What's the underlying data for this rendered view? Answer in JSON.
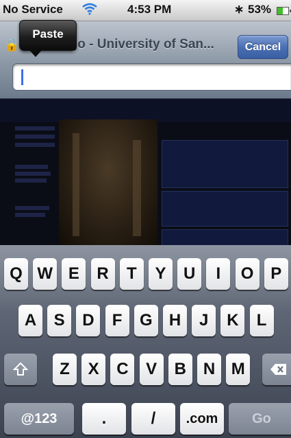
{
  "status_bar": {
    "carrier": "No Service",
    "wifi_icon": "wifi-icon",
    "time": "4:53 PM",
    "bluetooth_icon": "bluetooth-icon",
    "battery_percent": "53%",
    "battery_level": 0.53,
    "battery_color": "#3fbf28"
  },
  "address_bar": {
    "lock_icon": "lock-icon",
    "page_title": "San Diego - University of San...",
    "cancel_label": "Cancel",
    "url_value": "",
    "caret_color": "#3b6ef0"
  },
  "paste_popup": {
    "label": "Paste"
  },
  "keyboard": {
    "row1": [
      "Q",
      "W",
      "E",
      "R",
      "T",
      "Y",
      "U",
      "I",
      "O",
      "P"
    ],
    "row2": [
      "A",
      "S",
      "D",
      "F",
      "G",
      "H",
      "J",
      "K",
      "L"
    ],
    "row3": [
      "Z",
      "X",
      "C",
      "V",
      "B",
      "N",
      "M"
    ],
    "shift_icon": "shift-icon",
    "delete_icon": "delete-icon",
    "mode_label": "@123",
    "period_label": ".",
    "slash_label": "/",
    "dotcom_label": ".com",
    "go_label": "Go"
  }
}
